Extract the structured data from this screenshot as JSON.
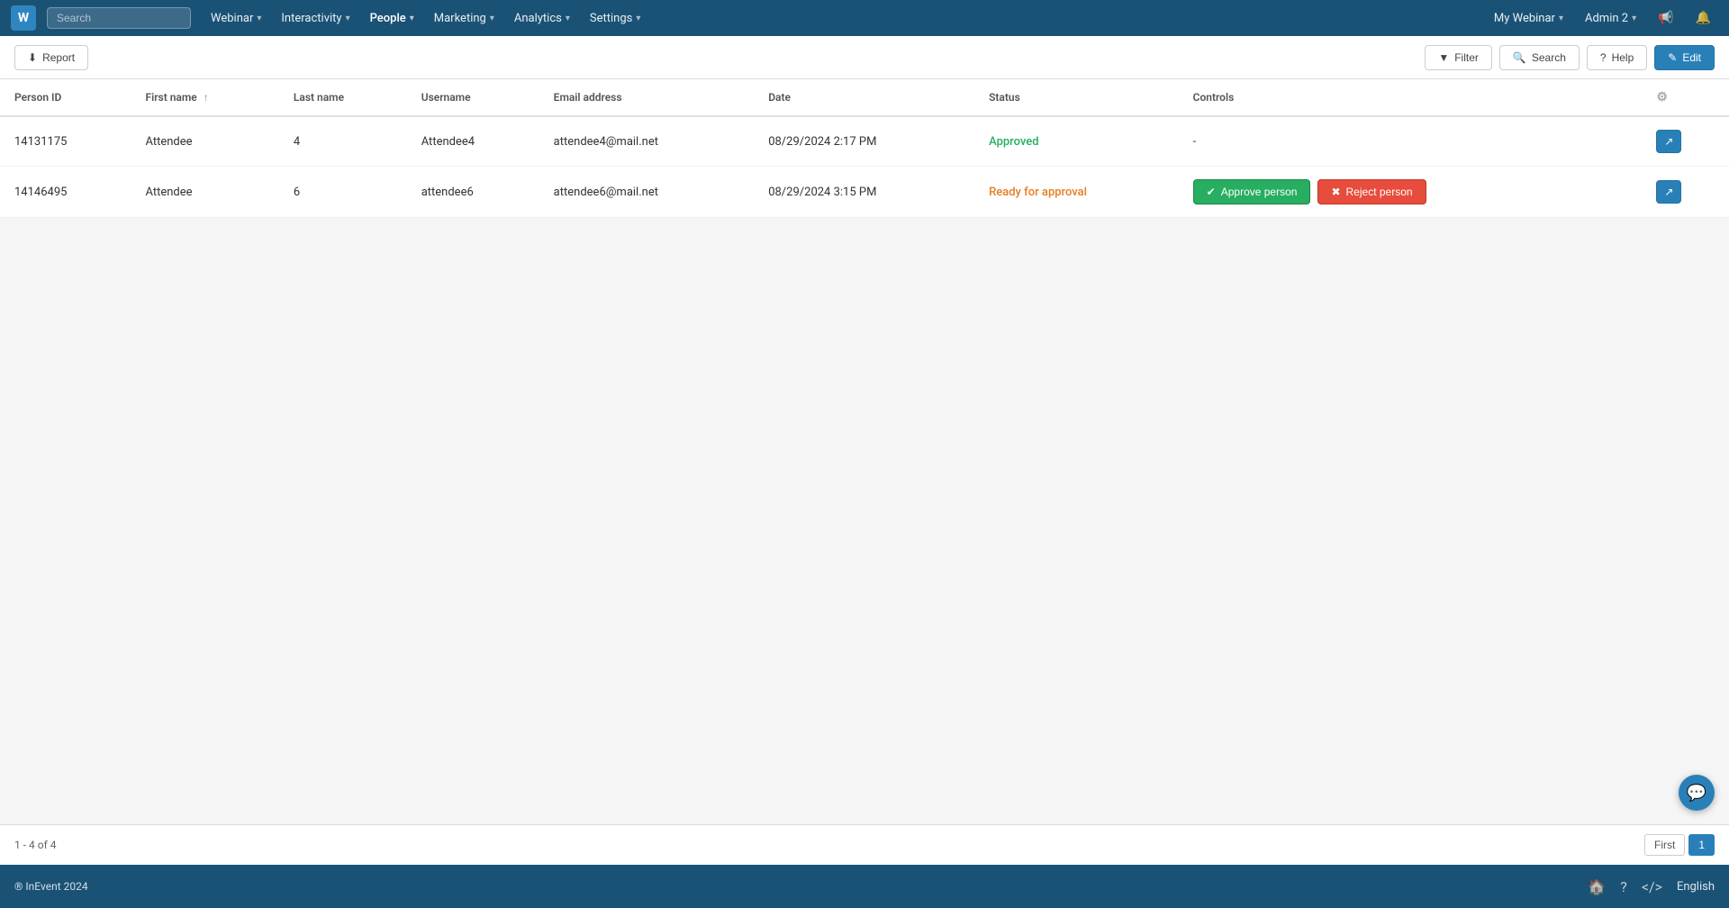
{
  "app": {
    "logo": "W",
    "search_placeholder": "Search"
  },
  "nav": {
    "items": [
      {
        "label": "Webinar",
        "has_dropdown": true
      },
      {
        "label": "Interactivity",
        "has_dropdown": true
      },
      {
        "label": "People",
        "has_dropdown": true,
        "active": true
      },
      {
        "label": "Marketing",
        "has_dropdown": true
      },
      {
        "label": "Analytics",
        "has_dropdown": true
      },
      {
        "label": "Settings",
        "has_dropdown": true
      }
    ],
    "right": {
      "webinar": "My Webinar",
      "admin": "Admin 2"
    }
  },
  "toolbar": {
    "report_label": "Report",
    "filter_label": "Filter",
    "search_label": "Search",
    "help_label": "Help",
    "edit_label": "Edit"
  },
  "table": {
    "columns": [
      {
        "key": "person_id",
        "label": "Person ID"
      },
      {
        "key": "first_name",
        "label": "First name",
        "sortable": true
      },
      {
        "key": "last_name",
        "label": "Last name"
      },
      {
        "key": "username",
        "label": "Username"
      },
      {
        "key": "email",
        "label": "Email address"
      },
      {
        "key": "date",
        "label": "Date"
      },
      {
        "key": "status",
        "label": "Status"
      },
      {
        "key": "controls",
        "label": "Controls"
      }
    ],
    "rows": [
      {
        "person_id": "14131175",
        "first_name": "Attendee",
        "last_name": "4",
        "username": "Attendee4",
        "email": "attendee4@mail.net",
        "date": "08/29/2024 2:17 PM",
        "status": "Approved",
        "status_type": "approved",
        "has_approve": false,
        "has_reject": false,
        "controls_dash": "-"
      },
      {
        "person_id": "14146495",
        "first_name": "Attendee",
        "last_name": "6",
        "username": "attendee6",
        "email": "attendee6@mail.net",
        "date": "08/29/2024 3:15 PM",
        "status": "Ready for approval",
        "status_type": "pending",
        "has_approve": true,
        "has_reject": true,
        "approve_label": "Approve person",
        "reject_label": "Reject person"
      }
    ]
  },
  "footer": {
    "range_text": "1 - 4 of 4",
    "pagination": {
      "first_label": "First",
      "page_1": "1"
    }
  },
  "bottom_bar": {
    "copyright": "® InEvent 2024",
    "language": "English"
  },
  "icons": {
    "report": "📋",
    "filter": "⚙",
    "search": "🔍",
    "help": "?",
    "edit": "✎",
    "settings_gear": "⚙",
    "approve": "✔",
    "reject": "✖",
    "external_link": "↗",
    "home": "🏠",
    "question": "?",
    "code": "</>",
    "chat": "💬",
    "sort_up": "↑",
    "bell": "🔔",
    "megaphone": "📢"
  }
}
